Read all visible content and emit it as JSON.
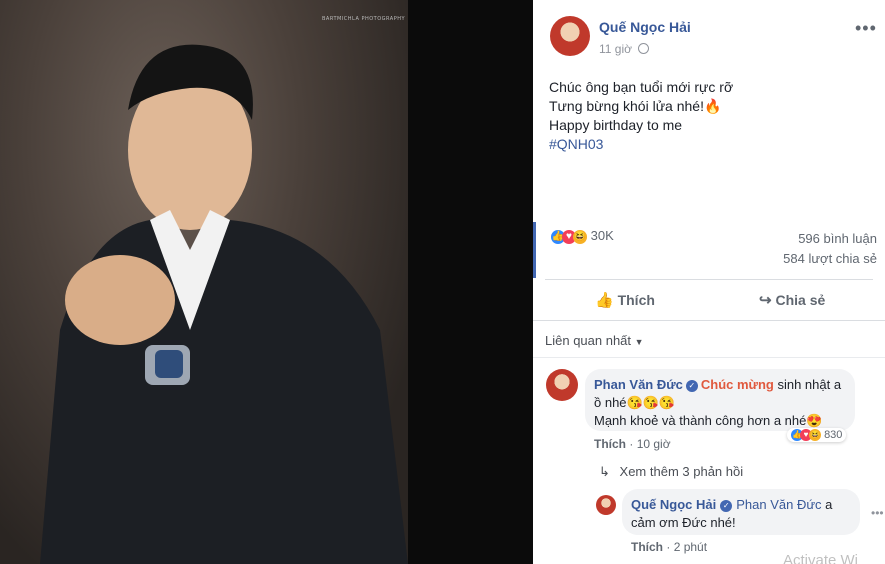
{
  "photo": {
    "watermark": "BARTMICHLA PHOTOGRAPHY"
  },
  "post": {
    "author": "Quế Ngọc Hải",
    "time": "11 giờ",
    "lines": [
      "Chúc ông bạn tuổi mới rực rỡ",
      "Tưng bừng khói lửa nhé!🔥",
      "Happy birthday to me",
      "#QNH03"
    ],
    "reactions_count": "30K",
    "comments_count": "596 bình luận",
    "shares_count": "584 lượt chia sẻ",
    "like_label": "Thích",
    "share_label": "Chia sẻ",
    "sort_label": "Liên quan nhất"
  },
  "comment1": {
    "author": "Phan Văn Đức",
    "highlight": "Chúc mừng",
    "text1_rest": " sinh nhật a",
    "text2": "ồ nhé😘😘😘",
    "text3": "Mạnh khoẻ và thành công hơn a nhé😍",
    "like": "Thích",
    "time": "10 giờ",
    "reactions": "830",
    "more_replies": "Xem thêm 3 phản hồi"
  },
  "reply": {
    "author": "Quế Ngọc Hải",
    "mention": "Phan Văn Đức",
    "text1_rest": " a",
    "text2": "cảm ơm Đức nhé!",
    "like": "Thích",
    "time": "2 phút"
  },
  "watermark_bottom": "Activate Wi"
}
